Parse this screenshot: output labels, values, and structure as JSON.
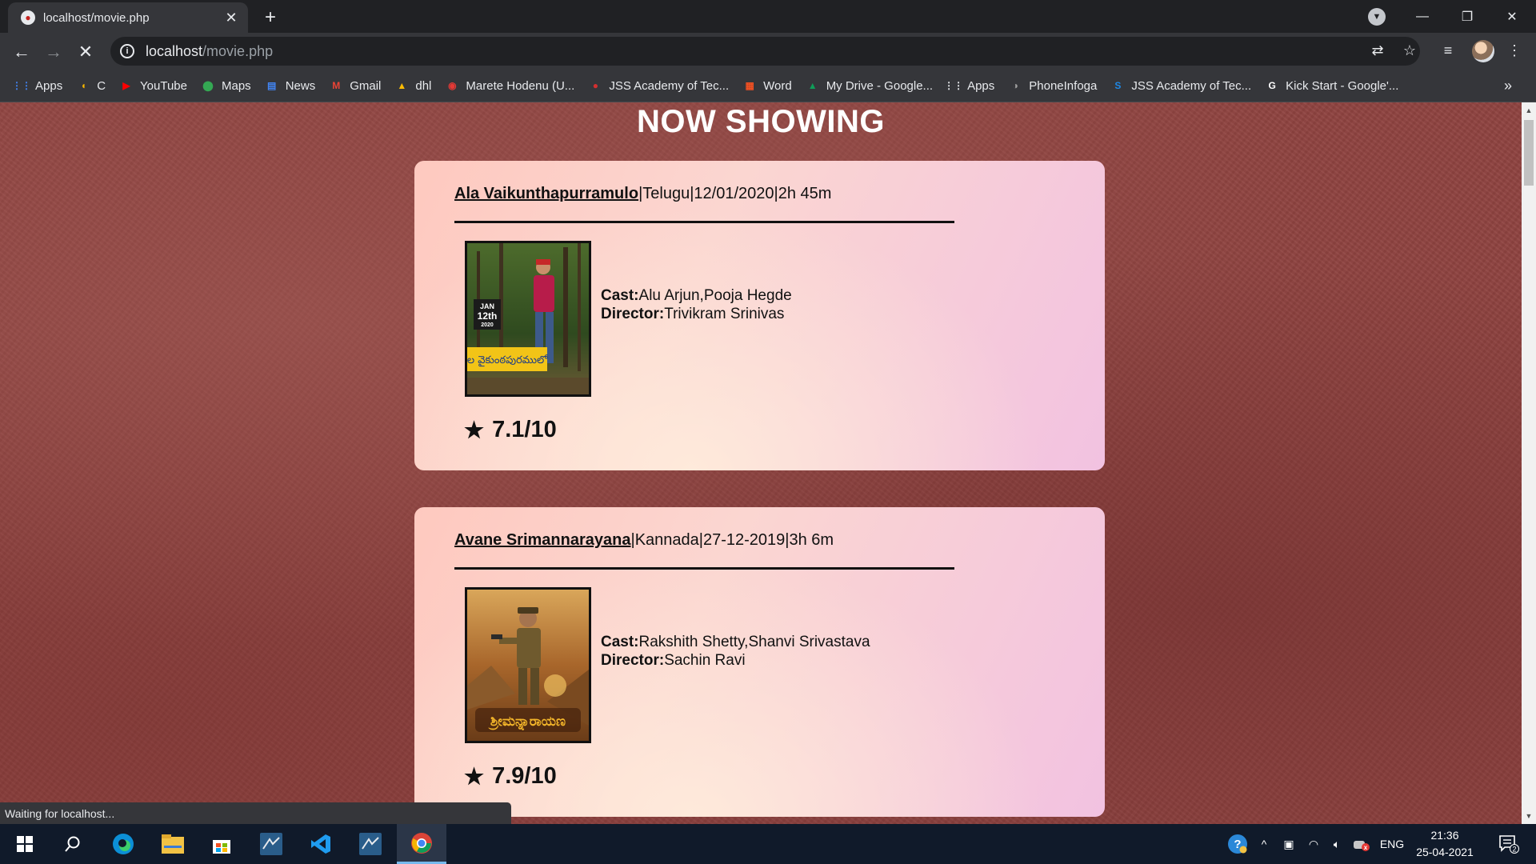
{
  "browser": {
    "tab_title": "localhost/movie.php",
    "url_host": "localhost",
    "url_path": "/movie.php",
    "status_text": "Waiting for localhost..."
  },
  "bookmarks": [
    {
      "label": "Apps",
      "icon": "apps-grid-icon",
      "color": "#4285f4"
    },
    {
      "label": "C",
      "icon": "codechef-icon",
      "color": "#f4b400"
    },
    {
      "label": "YouTube",
      "icon": "youtube-icon",
      "color": "#ff0000"
    },
    {
      "label": "Maps",
      "icon": "maps-icon",
      "color": "#34a853"
    },
    {
      "label": "News",
      "icon": "news-icon",
      "color": "#4285f4"
    },
    {
      "label": "Gmail",
      "icon": "gmail-icon",
      "color": "#ea4335"
    },
    {
      "label": "dhl",
      "icon": "drive-icon",
      "color": "#fbbc04"
    },
    {
      "label": "Marete Hodenu (U...",
      "icon": "music-icon",
      "color": "#e53935"
    },
    {
      "label": "JSS Academy of Tec...",
      "icon": "jss-icon",
      "color": "#d32f2f"
    },
    {
      "label": "Word",
      "icon": "microsoft-icon",
      "color": "#f25022"
    },
    {
      "label": "My Drive - Google...",
      "icon": "google-drive-icon",
      "color": "#0f9d58"
    },
    {
      "label": "Apps",
      "icon": "apps-grid-icon",
      "color": "#e8eaed"
    },
    {
      "label": "PhoneInfoga",
      "icon": "phoneinfoga-icon",
      "color": "#9e9e9e"
    },
    {
      "label": "JSS Academy of Tec...",
      "icon": "s-icon",
      "color": "#1e88e5"
    },
    {
      "label": "Kick Start - Google'...",
      "icon": "google-icon",
      "color": "#ffffff"
    }
  ],
  "page": {
    "title": "NOW SHOWING",
    "cast_label": "Cast:",
    "director_label": "Director:",
    "movies": [
      {
        "name": "Ala Vaikunthapurramulo",
        "language": "Telugu",
        "release_date": "12/01/2020",
        "duration": "2h 45m",
        "cast": "Alu Arjun,Pooja Hegde",
        "director": "Trivikram Srinivas",
        "rating": "7.1/10",
        "poster_text": "JAN 12th 2020 RELEASE"
      },
      {
        "name": "Avane Srimannarayana",
        "language": "Kannada",
        "release_date": "27-12-2019",
        "duration": "3h 6m",
        "cast": "Rakshith Shetty,Shanvi Srivastava",
        "director": "Sachin Ravi",
        "rating": "7.9/10",
        "poster_text": ""
      }
    ]
  },
  "taskbar": {
    "time": "21:36",
    "date": "25-04-2021",
    "language": "ENG",
    "notification_count": "2",
    "apps": [
      "windows-start-icon",
      "search-icon",
      "edge-icon",
      "file-explorer-icon",
      "store-icon",
      "mysql-workbench-icon",
      "vscode-icon",
      "mysql-workbench-icon",
      "chrome-icon"
    ]
  },
  "colors": {
    "page_background": "#8f4340",
    "card_gradient_start": "#fec9bf",
    "card_gradient_end": "#f2c2e1",
    "title_color": "#ffffff"
  }
}
